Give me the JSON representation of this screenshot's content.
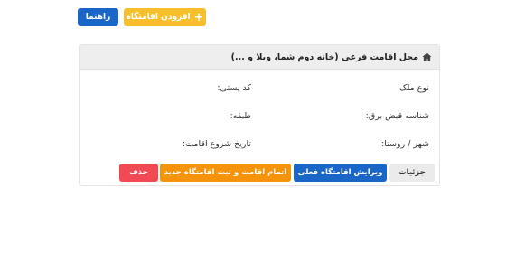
{
  "toolbar": {
    "add_label": "افزودن اقامتگاه",
    "guide_label": "راهنما"
  },
  "card": {
    "title": "محل اقامت فرعی (خانه دوم شما، ویلا و ...)",
    "fields": {
      "property_type": "نوع ملک:",
      "postal_code": "کد پستی:",
      "electricity_bill_id": "شناسه قبض برق:",
      "floor": "طبقه:",
      "city_village": "شهر / روستا:",
      "start_date": "تاریخ شروع اقامت:"
    },
    "actions": {
      "details": "جزئیات",
      "edit": "ویرایش اقامتگاه فعلی",
      "finish": "اتمام اقامت و ثبت اقامتگاه جدید",
      "delete": "حذف"
    }
  },
  "colors": {
    "warning": "#f7bf2b",
    "primary": "#1a66c7",
    "orange": "#f5930b",
    "danger": "#f24a55"
  },
  "icons": [
    "plus-icon",
    "home-icon"
  ]
}
